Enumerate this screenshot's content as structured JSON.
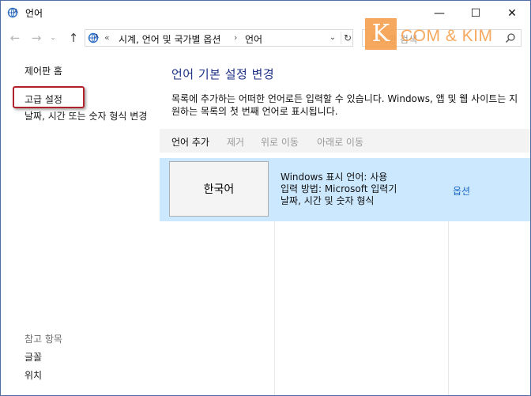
{
  "window": {
    "title": "언어",
    "minimize_glyph": "—",
    "maximize_glyph": "☐",
    "close_glyph": "✕"
  },
  "navigation": {
    "back_glyph": "←",
    "forward_glyph": "→",
    "recent_glyph": "⌄",
    "up_glyph": "↑",
    "address_separator": "«",
    "breadcrumbs": [
      "시계, 언어 및 국가별 옵션",
      "언어"
    ],
    "breadcrumb_arrow": "›",
    "dropdown_glyph": "⌄",
    "refresh_glyph": "↻",
    "search_placeholder": "제어판 검색"
  },
  "watermark": {
    "letter": "K",
    "text": "COM & KIM"
  },
  "left_pane": {
    "home": "제어판 홈",
    "advanced": "고급 설정",
    "datetime": "날짜, 시간 또는 숫자 형식 변경",
    "see_also_title": "참고 항목",
    "font": "글꼴",
    "location": "위치"
  },
  "main": {
    "title": "언어 기본 설정 변경",
    "description": "목록에 추가하는 어떠한 언어로든 입력할 수 있습니다. Windows, 앱 및 웹 사이트는 지원하는 목록의 첫 번째 언어로 표시됩니다.",
    "toolbar": {
      "add": "언어 추가",
      "remove": "제거",
      "move_up": "위로 이동",
      "move_down": "아래로 이동"
    },
    "languages": [
      {
        "name": "한국어",
        "details": [
          "Windows 표시 언어: 사용",
          "입력 방법: Microsoft 입력기",
          "날짜, 시간 및 숫자 형식"
        ],
        "options": "옵션"
      }
    ]
  },
  "colors": {
    "accent_title": "#1e3287",
    "link": "#1a66c2",
    "selected_row": "#cce8ff",
    "highlight_box": "#b2222c",
    "watermark": "#f6a04d"
  }
}
